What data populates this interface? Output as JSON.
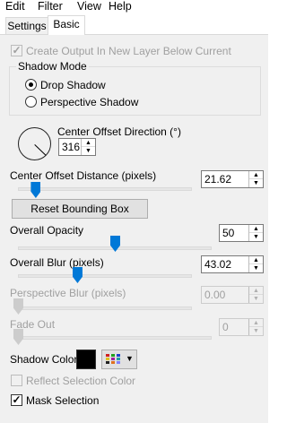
{
  "menubar": {
    "items": [
      "Edit",
      "Filter",
      "View",
      "Help"
    ]
  },
  "tabs": [
    "Settings",
    "Basic"
  ],
  "active_tab": "Basic",
  "create_output": {
    "label": "Create Output In New Layer Below Current",
    "checked": true,
    "disabled": true
  },
  "shadow_mode": {
    "title": "Shadow Mode",
    "options": [
      {
        "label": "Drop Shadow",
        "selected": true
      },
      {
        "label": "Perspective Shadow",
        "selected": false
      }
    ]
  },
  "center_offset_direction": {
    "label": "Center Offset Direction (°)",
    "value": "316"
  },
  "center_offset_distance": {
    "label": "Center Offset Distance (pixels)",
    "value": "21.62",
    "fraction": 0.1
  },
  "reset_button": {
    "label": "Reset Bounding Box"
  },
  "overall_opacity": {
    "label": "Overall Opacity",
    "value": "50",
    "fraction": 0.5
  },
  "overall_blur": {
    "label": "Overall Blur (pixels)",
    "value": "43.02",
    "fraction": 0.34
  },
  "perspective_blur": {
    "label": "Perspective Blur (pixels)",
    "value": "0.00",
    "fraction": 0,
    "disabled": true
  },
  "fade_out": {
    "label": "Fade Out",
    "value": "0",
    "fraction": 0,
    "disabled": true
  },
  "shadow_color": {
    "label": "Shadow Color",
    "color": "#000000"
  },
  "reflect_selection": {
    "label": "Reflect Selection Color",
    "checked": false,
    "disabled": true
  },
  "mask_selection": {
    "label": "Mask Selection",
    "checked": true
  },
  "colors": {
    "accent": "#0078d7",
    "panel_bg": "#f0f0f0"
  },
  "icons": {
    "palette": "color-grid-icon",
    "dropdown": "chevron-down-icon"
  }
}
